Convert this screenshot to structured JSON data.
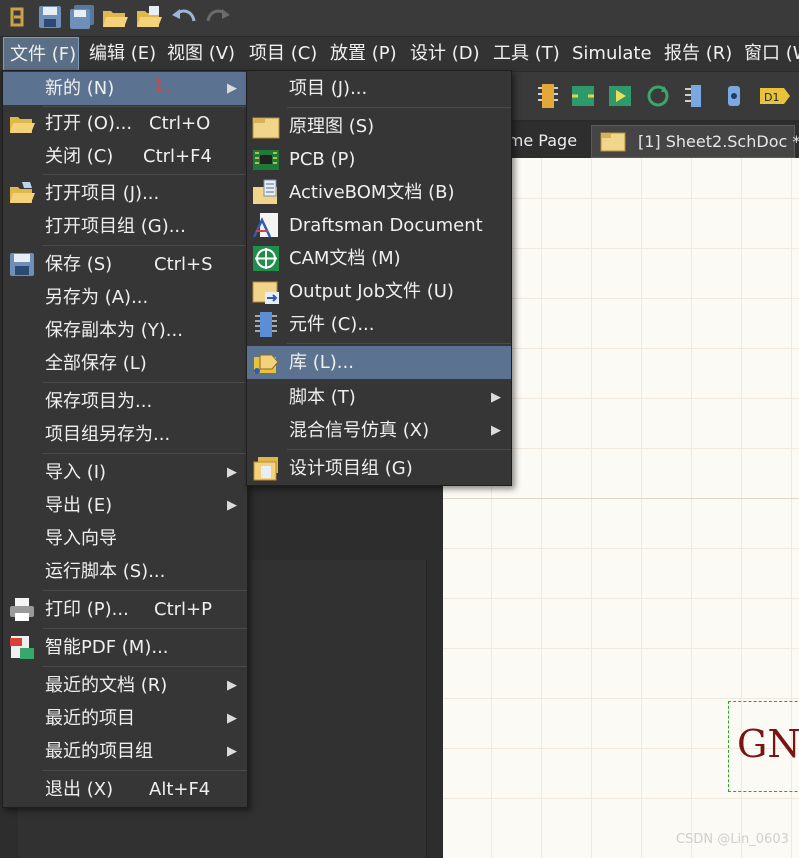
{
  "menubar": {
    "items": [
      {
        "label": "文件 (F)"
      },
      {
        "label": "编辑 (E)"
      },
      {
        "label": "视图 (V)"
      },
      {
        "label": "项目 (C)"
      },
      {
        "label": "放置 (P)"
      },
      {
        "label": "设计 (D)"
      },
      {
        "label": "工具 (T)"
      },
      {
        "label": "Simulate"
      },
      {
        "label": "报告 (R)"
      },
      {
        "label": "窗口 (W"
      }
    ]
  },
  "tabs": [
    {
      "label": "ome Page"
    },
    {
      "label": "[1] Sheet2.SchDoc *"
    }
  ],
  "file_menu": {
    "items": [
      {
        "label": "新的 (N)",
        "shortcut": "",
        "submenu": true,
        "icon": ""
      },
      {
        "label": "打开 (O)...",
        "shortcut": "Ctrl+O",
        "submenu": false,
        "icon": "open-folder-icon"
      },
      {
        "label": "关闭 (C)",
        "shortcut": "Ctrl+F4",
        "submenu": false,
        "icon": ""
      },
      {
        "label": "打开项目 (J)...",
        "shortcut": "",
        "submenu": false,
        "icon": "open-project-icon"
      },
      {
        "label": "打开项目组 (G)...",
        "shortcut": "",
        "submenu": false,
        "icon": ""
      },
      {
        "label": "保存 (S)",
        "shortcut": "Ctrl+S",
        "submenu": false,
        "icon": "save-icon"
      },
      {
        "label": "另存为 (A)...",
        "shortcut": "",
        "submenu": false,
        "icon": ""
      },
      {
        "label": "保存副本为 (Y)...",
        "shortcut": "",
        "submenu": false,
        "icon": ""
      },
      {
        "label": "全部保存 (L)",
        "shortcut": "",
        "submenu": false,
        "icon": ""
      },
      {
        "label": "保存项目为...",
        "shortcut": "",
        "submenu": false,
        "icon": ""
      },
      {
        "label": "项目组另存为...",
        "shortcut": "",
        "submenu": false,
        "icon": ""
      },
      {
        "label": "导入 (I)",
        "shortcut": "",
        "submenu": true,
        "icon": ""
      },
      {
        "label": "导出 (E)",
        "shortcut": "",
        "submenu": true,
        "icon": ""
      },
      {
        "label": "导入向导",
        "shortcut": "",
        "submenu": false,
        "icon": ""
      },
      {
        "label": "运行脚本 (S)...",
        "shortcut": "",
        "submenu": false,
        "icon": ""
      },
      {
        "label": "打印 (P)...",
        "shortcut": "Ctrl+P",
        "submenu": false,
        "icon": "printer-icon"
      },
      {
        "label": "智能PDF (M)...",
        "shortcut": "",
        "submenu": false,
        "icon": "smart-pdf-icon"
      },
      {
        "label": "最近的文档 (R)",
        "shortcut": "",
        "submenu": true,
        "icon": ""
      },
      {
        "label": "最近的项目",
        "shortcut": "",
        "submenu": true,
        "icon": ""
      },
      {
        "label": "最近的项目组",
        "shortcut": "",
        "submenu": true,
        "icon": ""
      },
      {
        "label": "退出 (X)",
        "shortcut": "Alt+F4",
        "submenu": false,
        "icon": ""
      }
    ]
  },
  "new_submenu": {
    "items": [
      {
        "label": "项目 (J)...",
        "submenu": false,
        "icon": ""
      },
      {
        "label": "原理图 (S)",
        "submenu": false,
        "icon": "schematic-icon"
      },
      {
        "label": "PCB (P)",
        "submenu": false,
        "icon": "pcb-icon"
      },
      {
        "label": "ActiveBOM文档 (B)",
        "submenu": false,
        "icon": "activebom-icon"
      },
      {
        "label": "Draftsman Document",
        "submenu": false,
        "icon": "draftsman-icon"
      },
      {
        "label": "CAM文档 (M)",
        "submenu": false,
        "icon": "cam-icon"
      },
      {
        "label": "Output Job文件 (U)",
        "submenu": false,
        "icon": "output-job-icon"
      },
      {
        "label": "元件 (C)...",
        "submenu": false,
        "icon": "component-icon"
      },
      {
        "label": "库 (L)...",
        "submenu": false,
        "icon": "library-icon"
      },
      {
        "label": "脚本 (T)",
        "submenu": true,
        "icon": ""
      },
      {
        "label": "混合信号仿真 (X)",
        "submenu": true,
        "icon": ""
      },
      {
        "label": "设计项目组 (G)",
        "submenu": false,
        "icon": "design-group-icon"
      }
    ]
  },
  "annotation": "1.",
  "canvas_text": "GNI",
  "watermark": "CSDN @Lin_0603",
  "colors": {
    "menu_bg": "#363636",
    "highlight": "#5b7391",
    "annotation": "#e0413a",
    "gnd_text": "#7a1414"
  }
}
